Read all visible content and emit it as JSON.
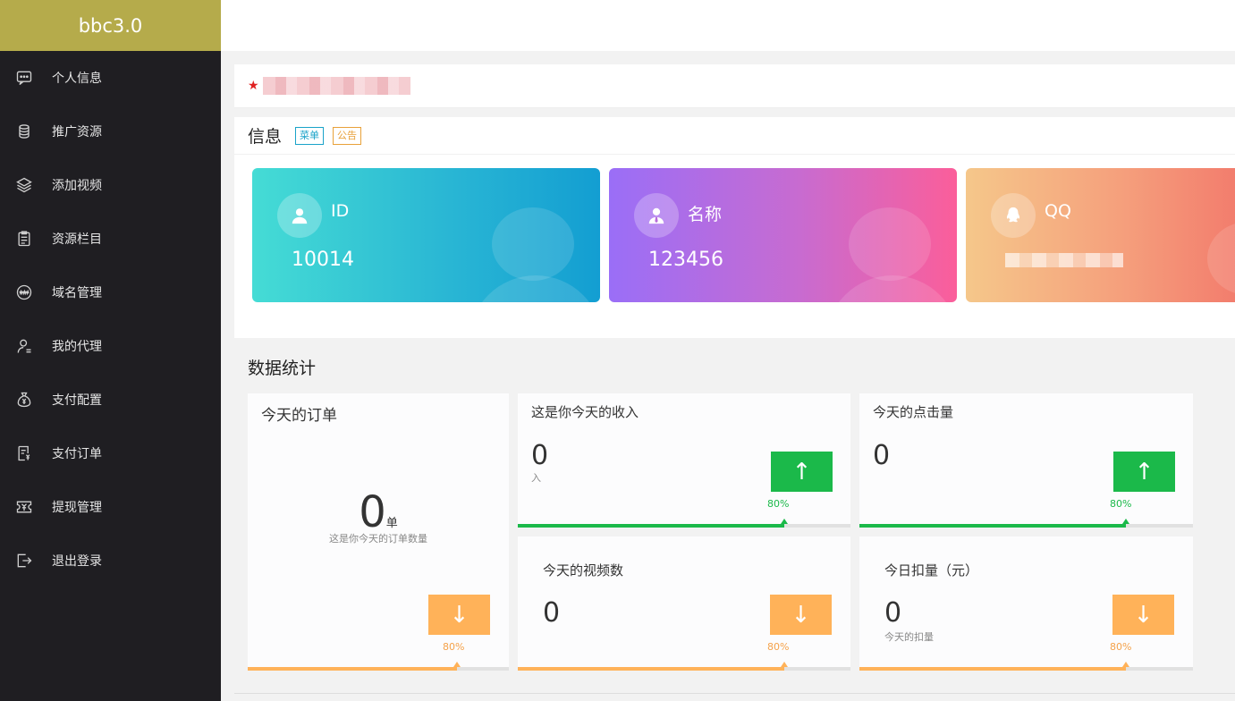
{
  "brand": "bbc3.0",
  "sidebar": {
    "items": [
      {
        "label": "个人信息",
        "icon": "message-icon"
      },
      {
        "label": "推广资源",
        "icon": "database-icon"
      },
      {
        "label": "添加视频",
        "icon": "layers-icon"
      },
      {
        "label": "资源栏目",
        "icon": "clipboard-icon"
      },
      {
        "label": "域名管理",
        "icon": "www-icon"
      },
      {
        "label": "我的代理",
        "icon": "user-icon"
      },
      {
        "label": "支付配置",
        "icon": "money-bag-icon"
      },
      {
        "label": "支付订单",
        "icon": "receipt-icon"
      },
      {
        "label": "提现管理",
        "icon": "ticket-icon"
      },
      {
        "label": "退出登录",
        "icon": "logout-icon"
      }
    ]
  },
  "info": {
    "title": "信息",
    "tags": [
      "菜单",
      "公告"
    ],
    "cards": [
      {
        "label": "ID",
        "value": "10014",
        "icon": "user-icon"
      },
      {
        "label": "名称",
        "value": "123456",
        "icon": "user-tie-icon"
      },
      {
        "label": "QQ",
        "value": "",
        "icon": "qq-icon"
      }
    ]
  },
  "stats": {
    "title": "数据统计",
    "orders": {
      "title": "今天的订单",
      "value": "0",
      "unit": "单",
      "sub": "这是你今天的订单数量",
      "pct": "80%",
      "progress": 0.8,
      "trend": "down"
    },
    "income": {
      "title": "这是你今天的收入",
      "value": "0",
      "sub": "入",
      "pct": "80%",
      "progress": 0.8,
      "trend": "up"
    },
    "clicks": {
      "title": "今天的点击量",
      "value": "0",
      "pct": "80%",
      "progress": 0.8,
      "trend": "up"
    },
    "videos": {
      "title": "今天的视频数",
      "value": "0",
      "pct": "80%",
      "progress": 0.8,
      "trend": "down"
    },
    "deduct": {
      "title": "今日扣量（元）",
      "value": "0",
      "sub": "今天的扣量",
      "pct": "80%",
      "progress": 0.8,
      "trend": "down"
    }
  },
  "arrows": {
    "up": "↑",
    "down": "↓"
  },
  "notice_star": "★",
  "colors": {
    "brand": "#b5ab4b",
    "sidebar": "#1f1e22",
    "up": "#1bb94a",
    "down": "#ffb259"
  }
}
